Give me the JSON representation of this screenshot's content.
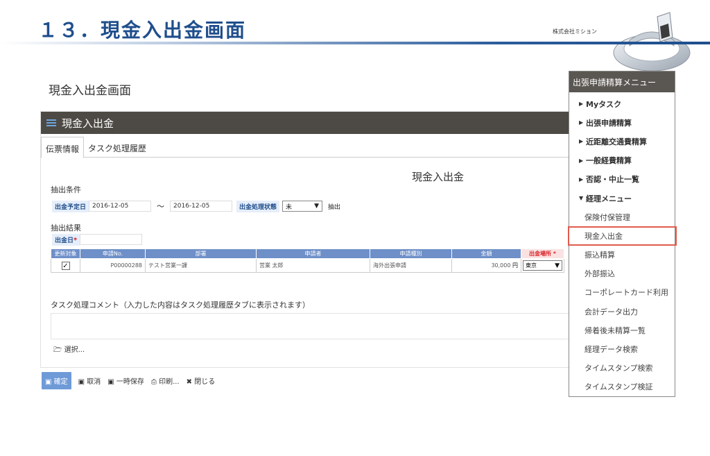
{
  "slide": {
    "title": "１３．現金入出金画面",
    "company": "株式会社ミション"
  },
  "page": {
    "heading": "現金入出金画面",
    "panel_title": "現金入出金",
    "tabs": [
      "伝票情報",
      "タスク処理履歴"
    ],
    "form_title": "現金入出金",
    "extraction_label": "抽出条件",
    "date_label": "出金予定日",
    "date_from": "2016-12-05",
    "tilde": "～",
    "date_to": "2016-12-05",
    "status_label": "出金処理状態",
    "status_value": "未",
    "extract_link": "抽出",
    "result_label": "抽出結果",
    "out_date_label": "出金日",
    "required_mark": "*",
    "table": {
      "headers": [
        "更新対象",
        "申請No.",
        "部署",
        "申請者",
        "申請種別",
        "金額",
        "出金場所 *"
      ],
      "rows": [
        {
          "checked": "✓",
          "no": "P00000288",
          "dept": "テスト営業一課",
          "applicant": "営業 太郎",
          "type": "海外出張申請",
          "amount": "30,000",
          "unit": "円",
          "place": "東京"
        }
      ]
    },
    "comment_label": "タスク処理コメント（入力した内容はタスク処理履歴タブに表示されます）",
    "attach_label": "選択..."
  },
  "actions": {
    "confirm": "確定",
    "cancel": "取消",
    "temp_save": "一時保存",
    "print": "印刷...",
    "close": "閉じる"
  },
  "menu": {
    "title": "出張申請精算メニュー",
    "items": [
      {
        "label": "Myタスク",
        "kind": "group"
      },
      {
        "label": "出張申請精算",
        "kind": "group"
      },
      {
        "label": "近距離交通費精算",
        "kind": "group"
      },
      {
        "label": "一般経費精算",
        "kind": "group"
      },
      {
        "label": "否認・中止一覧",
        "kind": "group"
      },
      {
        "label": "経理メニュー",
        "kind": "group-open"
      },
      {
        "label": "保険付保管理",
        "kind": "sub"
      },
      {
        "label": "現金入出金",
        "kind": "sub-selected"
      },
      {
        "label": "振込精算",
        "kind": "sub"
      },
      {
        "label": "外部振込",
        "kind": "sub"
      },
      {
        "label": "コーポレートカード利用",
        "kind": "sub"
      },
      {
        "label": "会計データ出力",
        "kind": "sub"
      },
      {
        "label": "帰着後未精算一覧",
        "kind": "sub"
      },
      {
        "label": "経理データ検索",
        "kind": "sub"
      },
      {
        "label": "タイムスタンプ検索",
        "kind": "sub"
      },
      {
        "label": "タイムスタンプ検証",
        "kind": "sub"
      }
    ]
  }
}
